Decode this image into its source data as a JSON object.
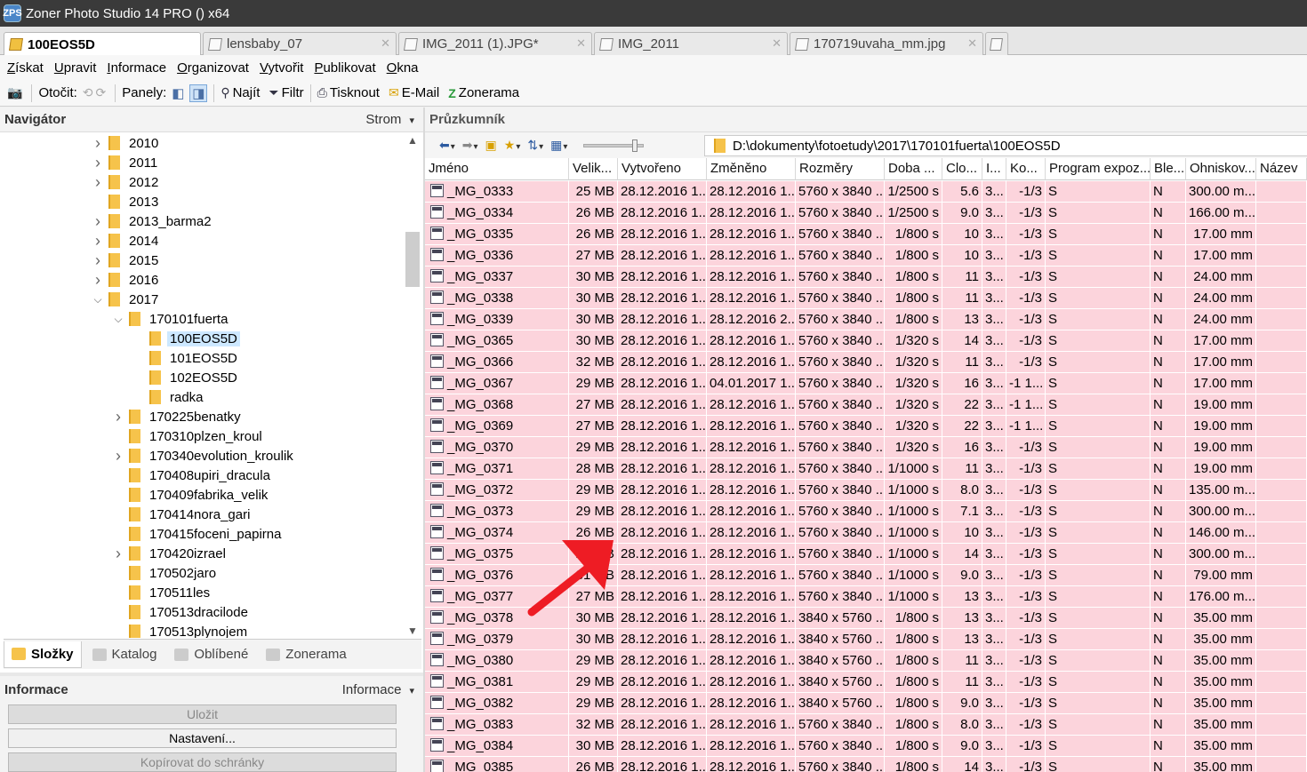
{
  "window": {
    "title": "Zoner Photo Studio 14 PRO  () x64",
    "logo": "ZPS"
  },
  "tabs": [
    {
      "label": "100EOS5D",
      "active": true
    },
    {
      "label": "lensbaby_07",
      "active": false
    },
    {
      "label": "IMG_2011 (1).JPG*",
      "active": false
    },
    {
      "label": "IMG_2011",
      "active": false
    },
    {
      "label": "170719uvaha_mm.jpg",
      "active": false
    }
  ],
  "menu": [
    "Získat",
    "Upravit",
    "Informace",
    "Organizovat",
    "Vytvořit",
    "Publikovat",
    "Okna"
  ],
  "toolbar": {
    "rotate_label": "Otočit:",
    "panels_label": "Panely:",
    "find_label": "Najít",
    "filter_label": "Filtr",
    "print_label": "Tisknout",
    "email_label": "E-Mail",
    "zonerama_label": "Zonerama"
  },
  "navigator": {
    "title": "Navigátor",
    "view": "Strom",
    "tree": [
      {
        "label": "2010",
        "depth": 0,
        "expander": "collapsed"
      },
      {
        "label": "2011",
        "depth": 0,
        "expander": "collapsed"
      },
      {
        "label": "2012",
        "depth": 0,
        "expander": "collapsed"
      },
      {
        "label": "2013",
        "depth": 0,
        "expander": "none"
      },
      {
        "label": "2013_barma2",
        "depth": 0,
        "expander": "collapsed"
      },
      {
        "label": "2014",
        "depth": 0,
        "expander": "collapsed"
      },
      {
        "label": "2015",
        "depth": 0,
        "expander": "collapsed"
      },
      {
        "label": "2016",
        "depth": 0,
        "expander": "collapsed"
      },
      {
        "label": "2017",
        "depth": 0,
        "expander": "expanded"
      },
      {
        "label": "170101fuerta",
        "depth": 1,
        "expander": "expanded"
      },
      {
        "label": "100EOS5D",
        "depth": 2,
        "expander": "none",
        "selected": true
      },
      {
        "label": "101EOS5D",
        "depth": 2,
        "expander": "none"
      },
      {
        "label": "102EOS5D",
        "depth": 2,
        "expander": "none"
      },
      {
        "label": "radka",
        "depth": 2,
        "expander": "none"
      },
      {
        "label": "170225benatky",
        "depth": 1,
        "expander": "collapsed"
      },
      {
        "label": "170310plzen_kroul",
        "depth": 1,
        "expander": "none"
      },
      {
        "label": "170340evolution_kroulik",
        "depth": 1,
        "expander": "collapsed"
      },
      {
        "label": "170408upiri_dracula",
        "depth": 1,
        "expander": "none"
      },
      {
        "label": "170409fabrika_velik",
        "depth": 1,
        "expander": "none"
      },
      {
        "label": "170414nora_gari",
        "depth": 1,
        "expander": "none"
      },
      {
        "label": "170415foceni_papirna",
        "depth": 1,
        "expander": "none"
      },
      {
        "label": "170420izrael",
        "depth": 1,
        "expander": "collapsed"
      },
      {
        "label": "170502jaro",
        "depth": 1,
        "expander": "none"
      },
      {
        "label": "170511les",
        "depth": 1,
        "expander": "none"
      },
      {
        "label": "170513dracilode",
        "depth": 1,
        "expander": "none"
      },
      {
        "label": "170513plynojem",
        "depth": 1,
        "expander": "none"
      }
    ],
    "tabs": [
      {
        "label": "Složky",
        "active": true
      },
      {
        "label": "Katalog",
        "active": false
      },
      {
        "label": "Oblíbené",
        "active": false
      },
      {
        "label": "Zonerama",
        "active": false
      }
    ]
  },
  "info": {
    "title": "Informace",
    "view": "Informace",
    "save_label": "Uložit",
    "settings_label": "Nastavení...",
    "copy_label": "Kopírovat do schránky"
  },
  "explorer": {
    "title": "Průzkumník",
    "path": "D:\\dokumenty\\fotoetudy\\2017\\170101fuerta\\100EOS5D",
    "columns": [
      "Jméno",
      "Velik...",
      "Vytvořeno",
      "Změněno",
      "Rozměry",
      "Doba ...",
      "Clo...",
      "I...",
      "Ko...",
      "Program expoz...",
      "Ble...",
      "Ohniskov...",
      "Název"
    ],
    "rows": [
      [
        "_MG_0333",
        "25 MB",
        "28.12.2016 1...",
        "28.12.2016 1...",
        "5760 x 3840 ...",
        "1/2500 s",
        "5.6",
        "3...",
        "-1/3",
        "S",
        "N",
        "300.00 m...",
        ""
      ],
      [
        "_MG_0334",
        "26 MB",
        "28.12.2016 1...",
        "28.12.2016 1...",
        "5760 x 3840 ...",
        "1/2500 s",
        "9.0",
        "3...",
        "-1/3",
        "S",
        "N",
        "166.00 m...",
        ""
      ],
      [
        "_MG_0335",
        "26 MB",
        "28.12.2016 1...",
        "28.12.2016 1...",
        "5760 x 3840 ...",
        "1/800 s",
        "10",
        "3...",
        "-1/3",
        "S",
        "N",
        "17.00 mm",
        ""
      ],
      [
        "_MG_0336",
        "27 MB",
        "28.12.2016 1...",
        "28.12.2016 1...",
        "5760 x 3840 ...",
        "1/800 s",
        "10",
        "3...",
        "-1/3",
        "S",
        "N",
        "17.00 mm",
        ""
      ],
      [
        "_MG_0337",
        "30 MB",
        "28.12.2016 1...",
        "28.12.2016 1...",
        "5760 x 3840 ...",
        "1/800 s",
        "11",
        "3...",
        "-1/3",
        "S",
        "N",
        "24.00 mm",
        ""
      ],
      [
        "_MG_0338",
        "30 MB",
        "28.12.2016 1...",
        "28.12.2016 1...",
        "5760 x 3840 ...",
        "1/800 s",
        "11",
        "3...",
        "-1/3",
        "S",
        "N",
        "24.00 mm",
        ""
      ],
      [
        "_MG_0339",
        "30 MB",
        "28.12.2016 1...",
        "28.12.2016 2...",
        "5760 x 3840 ...",
        "1/800 s",
        "13",
        "3...",
        "-1/3",
        "S",
        "N",
        "24.00 mm",
        ""
      ],
      [
        "_MG_0365",
        "30 MB",
        "28.12.2016 1...",
        "28.12.2016 1...",
        "5760 x 3840 ...",
        "1/320 s",
        "14",
        "3...",
        "-1/3",
        "S",
        "N",
        "17.00 mm",
        ""
      ],
      [
        "_MG_0366",
        "32 MB",
        "28.12.2016 1...",
        "28.12.2016 1...",
        "5760 x 3840 ...",
        "1/320 s",
        "11",
        "3...",
        "-1/3",
        "S",
        "N",
        "17.00 mm",
        ""
      ],
      [
        "_MG_0367",
        "29 MB",
        "28.12.2016 1...",
        "04.01.2017 1...",
        "5760 x 3840 ...",
        "1/320 s",
        "16",
        "3...",
        "-1 1...",
        "S",
        "N",
        "17.00 mm",
        ""
      ],
      [
        "_MG_0368",
        "27 MB",
        "28.12.2016 1...",
        "28.12.2016 1...",
        "5760 x 3840 ...",
        "1/320 s",
        "22",
        "3...",
        "-1 1...",
        "S",
        "N",
        "19.00 mm",
        ""
      ],
      [
        "_MG_0369",
        "27 MB",
        "28.12.2016 1...",
        "28.12.2016 1...",
        "5760 x 3840 ...",
        "1/320 s",
        "22",
        "3...",
        "-1 1...",
        "S",
        "N",
        "19.00 mm",
        ""
      ],
      [
        "_MG_0370",
        "29 MB",
        "28.12.2016 1...",
        "28.12.2016 1...",
        "5760 x 3840 ...",
        "1/320 s",
        "16",
        "3...",
        "-1/3",
        "S",
        "N",
        "19.00 mm",
        ""
      ],
      [
        "_MG_0371",
        "28 MB",
        "28.12.2016 1...",
        "28.12.2016 1...",
        "5760 x 3840 ...",
        "1/1000 s",
        "11",
        "3...",
        "-1/3",
        "S",
        "N",
        "19.00 mm",
        ""
      ],
      [
        "_MG_0372",
        "29 MB",
        "28.12.2016 1...",
        "28.12.2016 1...",
        "5760 x 3840 ...",
        "1/1000 s",
        "8.0",
        "3...",
        "-1/3",
        "S",
        "N",
        "135.00 m...",
        ""
      ],
      [
        "_MG_0373",
        "29 MB",
        "28.12.2016 1...",
        "28.12.2016 1...",
        "5760 x 3840 ...",
        "1/1000 s",
        "7.1",
        "3...",
        "-1/3",
        "S",
        "N",
        "300.00 m...",
        ""
      ],
      [
        "_MG_0374",
        "26 MB",
        "28.12.2016 1...",
        "28.12.2016 1...",
        "5760 x 3840 ...",
        "1/1000 s",
        "10",
        "3...",
        "-1/3",
        "S",
        "N",
        "146.00 m...",
        ""
      ],
      [
        "_MG_0375",
        "26 MB",
        "28.12.2016 1...",
        "28.12.2016 1...",
        "5760 x 3840 ...",
        "1/1000 s",
        "14",
        "3...",
        "-1/3",
        "S",
        "N",
        "300.00 m...",
        ""
      ],
      [
        "_MG_0376",
        "31 MB",
        "28.12.2016 1...",
        "28.12.2016 1...",
        "5760 x 3840 ...",
        "1/1000 s",
        "9.0",
        "3...",
        "-1/3",
        "S",
        "N",
        "79.00 mm",
        ""
      ],
      [
        "_MG_0377",
        "27 MB",
        "28.12.2016 1...",
        "28.12.2016 1...",
        "5760 x 3840 ...",
        "1/1000 s",
        "13",
        "3...",
        "-1/3",
        "S",
        "N",
        "176.00 m...",
        ""
      ],
      [
        "_MG_0378",
        "30 MB",
        "28.12.2016 1...",
        "28.12.2016 1...",
        "3840 x 5760 ...",
        "1/800 s",
        "13",
        "3...",
        "-1/3",
        "S",
        "N",
        "35.00 mm",
        ""
      ],
      [
        "_MG_0379",
        "30 MB",
        "28.12.2016 1...",
        "28.12.2016 1...",
        "3840 x 5760 ...",
        "1/800 s",
        "13",
        "3...",
        "-1/3",
        "S",
        "N",
        "35.00 mm",
        ""
      ],
      [
        "_MG_0380",
        "29 MB",
        "28.12.2016 1...",
        "28.12.2016 1...",
        "3840 x 5760 ...",
        "1/800 s",
        "11",
        "3...",
        "-1/3",
        "S",
        "N",
        "35.00 mm",
        ""
      ],
      [
        "_MG_0381",
        "29 MB",
        "28.12.2016 1...",
        "28.12.2016 1...",
        "3840 x 5760 ...",
        "1/800 s",
        "11",
        "3...",
        "-1/3",
        "S",
        "N",
        "35.00 mm",
        ""
      ],
      [
        "_MG_0382",
        "29 MB",
        "28.12.2016 1...",
        "28.12.2016 1...",
        "3840 x 5760 ...",
        "1/800 s",
        "9.0",
        "3...",
        "-1/3",
        "S",
        "N",
        "35.00 mm",
        ""
      ],
      [
        "_MG_0383",
        "32 MB",
        "28.12.2016 1...",
        "28.12.2016 1...",
        "5760 x 3840 ...",
        "1/800 s",
        "8.0",
        "3...",
        "-1/3",
        "S",
        "N",
        "35.00 mm",
        ""
      ],
      [
        "_MG_0384",
        "30 MB",
        "28.12.2016 1...",
        "28.12.2016 1...",
        "5760 x 3840 ...",
        "1/800 s",
        "9.0",
        "3...",
        "-1/3",
        "S",
        "N",
        "35.00 mm",
        ""
      ],
      [
        "_MG_0385",
        "26 MB",
        "28.12.2016 1...",
        "28.12.2016 1...",
        "5760 x 3840 ...",
        "1/800 s",
        "14",
        "3...",
        "-1/3",
        "S",
        "N",
        "35.00 mm",
        ""
      ]
    ],
    "row_color": "#fcd4dc"
  },
  "annotation": {
    "arrow_color": "#ee1c24"
  }
}
